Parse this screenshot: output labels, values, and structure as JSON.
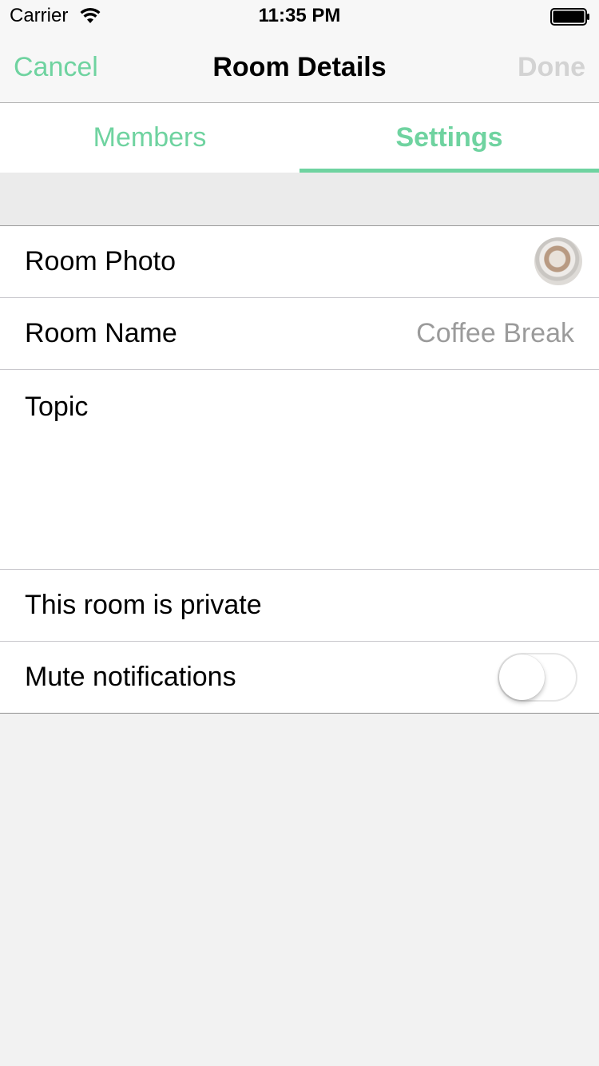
{
  "status_bar": {
    "carrier": "Carrier",
    "time": "11:35 PM"
  },
  "nav": {
    "cancel_label": "Cancel",
    "title": "Room Details",
    "done_label": "Done"
  },
  "tabs": [
    {
      "label": "Members",
      "active": false
    },
    {
      "label": "Settings",
      "active": true
    }
  ],
  "settings": {
    "room_photo": {
      "label": "Room Photo"
    },
    "room_name": {
      "label": "Room Name",
      "value": "Coffee Break"
    },
    "topic": {
      "label": "Topic"
    },
    "private": {
      "label": "This room is private"
    },
    "mute": {
      "label": "Mute notifications",
      "enabled": false
    }
  },
  "colors": {
    "accent": "#6fd3a0",
    "disabled": "#d3d3d3",
    "secondary_text": "#9b9b9b"
  }
}
